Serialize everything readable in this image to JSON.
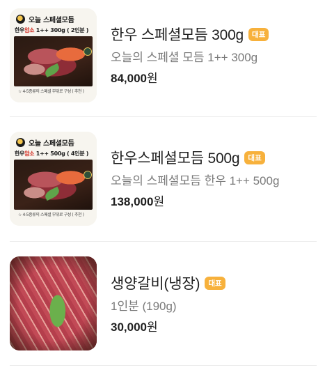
{
  "badge_label": "대표",
  "items": [
    {
      "name": "한우 스페셜모듬 300g",
      "description": "오늘의 스페셜 모듬 1++ 300g",
      "price": "84,000",
      "currency": "원",
      "image": {
        "kind": "promo-card",
        "title": "오늘 스페셜모듬",
        "sub_a": "한우",
        "sub_b": "암소",
        "sub_c": "1++ 300g",
        "sub_d": "( 2인분 )",
        "foot": "☆ 4-5종류의 스페셜 부위로 구성 ( 추천 )"
      }
    },
    {
      "name": "한우스페셜모듬 500g",
      "description": "오늘의 스페셜모듬 한우 1++ 500g",
      "price": "138,000",
      "currency": "원",
      "image": {
        "kind": "promo-card",
        "title": "오늘 스페셜모듬",
        "sub_a": "한우",
        "sub_b": "암소",
        "sub_c": "1++ 500g",
        "sub_d": "( 4인분 )",
        "foot": "☆ 4-5종류의 스페셜 부위로 구성 ( 추천 )"
      }
    },
    {
      "name": "생양갈비(냉장)",
      "description": "1인분 (190g)",
      "price": "30,000",
      "currency": "원",
      "image": {
        "kind": "photo",
        "subject": "lamb-ribs"
      }
    }
  ],
  "colors": {
    "badge": "#f7b13c",
    "name": "#1f1f1f",
    "description": "#7a7a7a",
    "divider": "#ececec"
  }
}
